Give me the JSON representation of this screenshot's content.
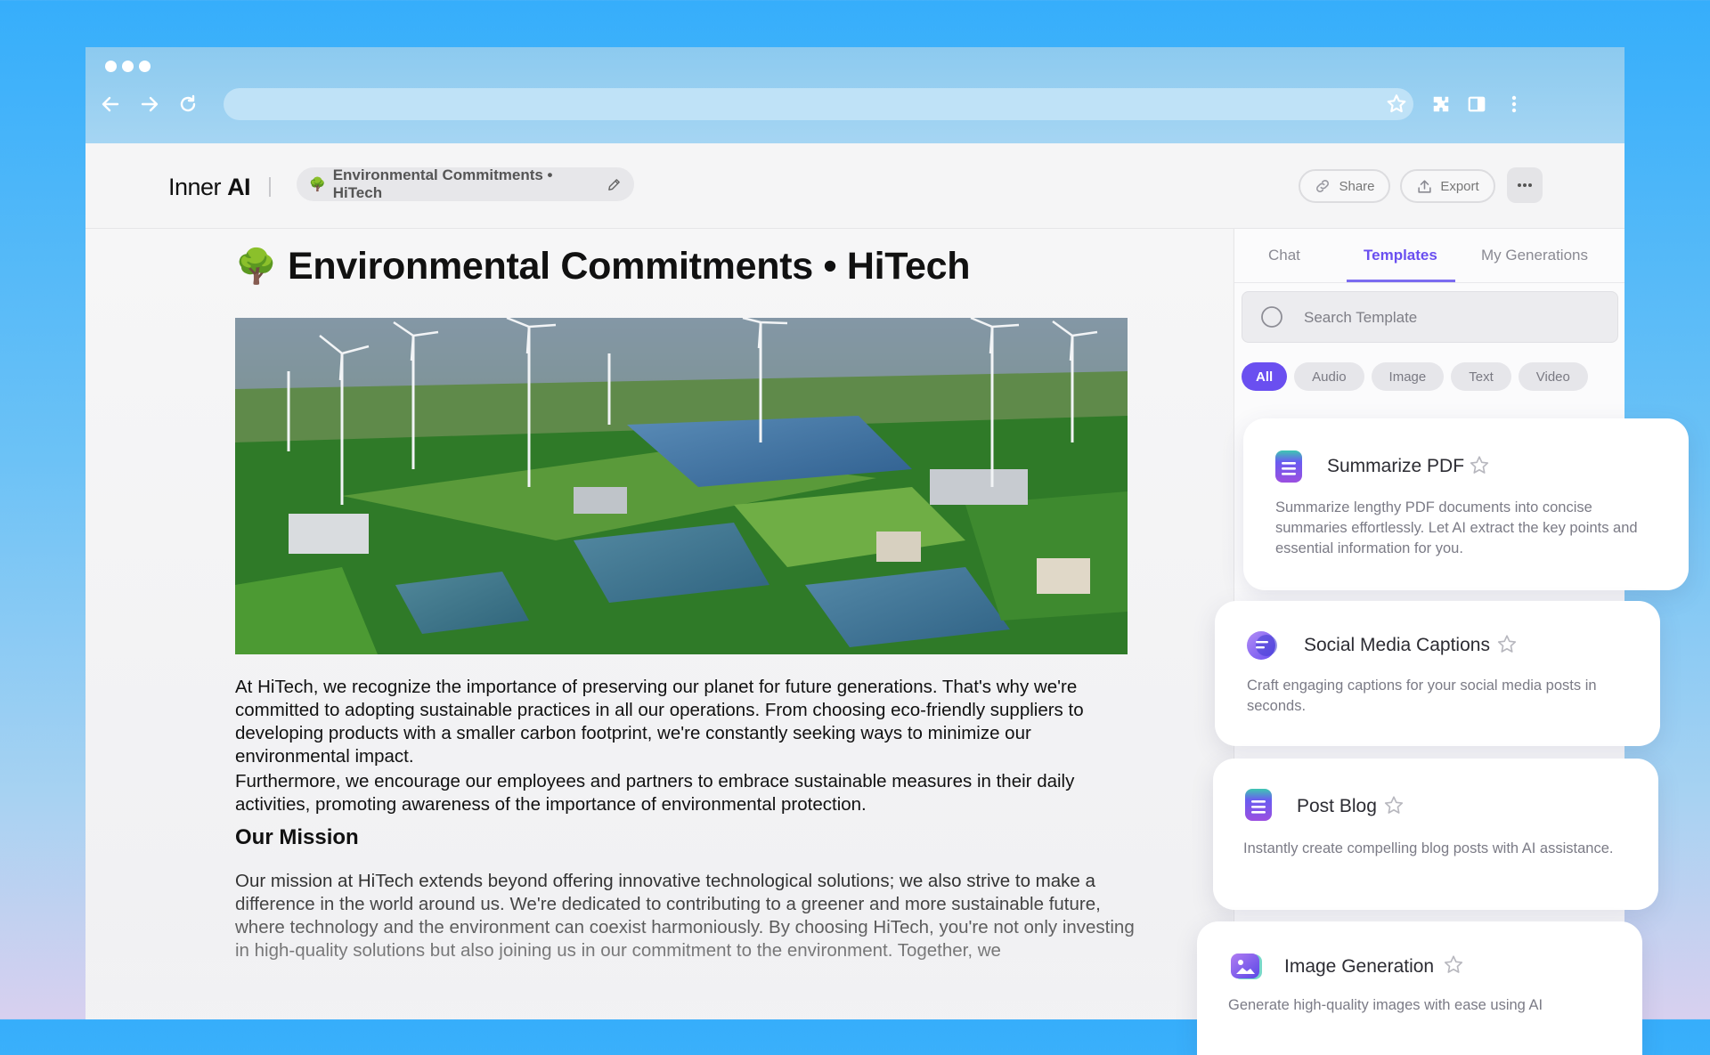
{
  "browser": {
    "icons": [
      "back-arrow-icon",
      "forward-arrow-icon",
      "reload-icon",
      "bookmark-star-icon",
      "extensions-puzzle-icon",
      "sidebar-icon",
      "kebab-menu-icon"
    ]
  },
  "header": {
    "logo_regular": "Inner",
    "logo_bold": "AI",
    "doc_pill_label": "Environmental Commitments • HiTech",
    "share_label": "Share",
    "export_label": "Export"
  },
  "document": {
    "title": "Environmental Commitments • HiTech",
    "emoji": "🌳",
    "paragraph1": "At HiTech, we recognize the importance of preserving our planet for future generations. That's why we're committed to adopting sustainable practices in all our operations. From choosing eco-friendly suppliers to developing products with a smaller carbon footprint, we're constantly seeking ways to minimize our environmental impact.",
    "paragraph2": "Furthermore, we encourage our employees and partners to embrace sustainable measures in their daily activities, promoting awareness of the importance of environmental protection.",
    "section_heading": "Our Mission",
    "paragraph3": "Our mission at HiTech extends beyond offering innovative technological solutions; we also strive to make a difference in the world around us. We're dedicated to contributing to a greener and more sustainable future, where technology and the environment can coexist harmoniously. By choosing HiTech, you're not only investing in high-quality solutions but also joining us in our commitment to the environment. Together, we"
  },
  "panel": {
    "tabs": [
      {
        "label": "Chat",
        "active": false
      },
      {
        "label": "Templates",
        "active": true
      },
      {
        "label": "My Generations",
        "active": false
      }
    ],
    "search_placeholder": "Search Template",
    "filters": [
      {
        "label": "All",
        "active": true
      },
      {
        "label": "Audio",
        "active": false
      },
      {
        "label": "Image",
        "active": false
      },
      {
        "label": "Text",
        "active": false
      },
      {
        "label": "Video",
        "active": false
      }
    ]
  },
  "templates": [
    {
      "title": "Summarize PDF",
      "description": "Summarize lengthy PDF documents into concise summaries effortlessly. Let AI extract the key points and essential information for you.",
      "icon": "document-lines-icon"
    },
    {
      "title": "Social Media Captions",
      "description": "Craft engaging captions for your social media posts in seconds.",
      "icon": "chat-bubble-icon"
    },
    {
      "title": "Post Blog",
      "description": "Instantly create compelling blog posts with AI assistance.",
      "icon": "document-lines-icon"
    },
    {
      "title": "Image Generation",
      "description": "Generate high-quality images with ease using AI",
      "icon": "image-icon"
    }
  ],
  "colors": {
    "accent": "#6a4ff0",
    "background_top": "#36aefb"
  }
}
